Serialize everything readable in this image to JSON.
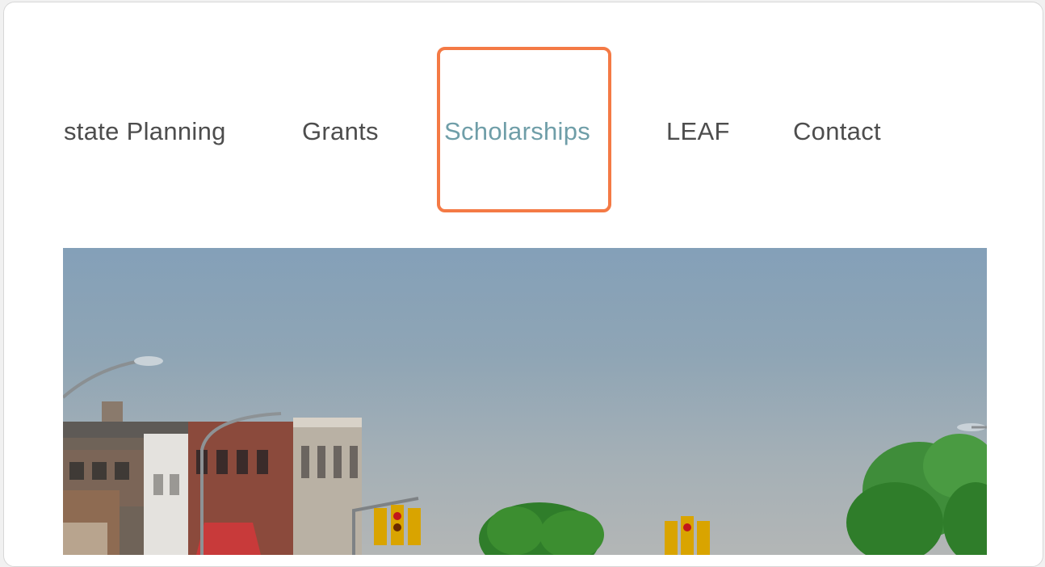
{
  "nav": {
    "items": [
      {
        "label": "state Planning",
        "active": false
      },
      {
        "label": "Grants",
        "active": false
      },
      {
        "label": "Scholarships",
        "active": true
      },
      {
        "label": "LEAF",
        "active": false
      },
      {
        "label": "Contact",
        "active": false
      }
    ]
  },
  "colors": {
    "nav_text": "#4d4d4d",
    "nav_active": "#6f9ea8",
    "highlight": "#f47a45"
  },
  "hero": {
    "icon": "downtown-street-photo"
  }
}
